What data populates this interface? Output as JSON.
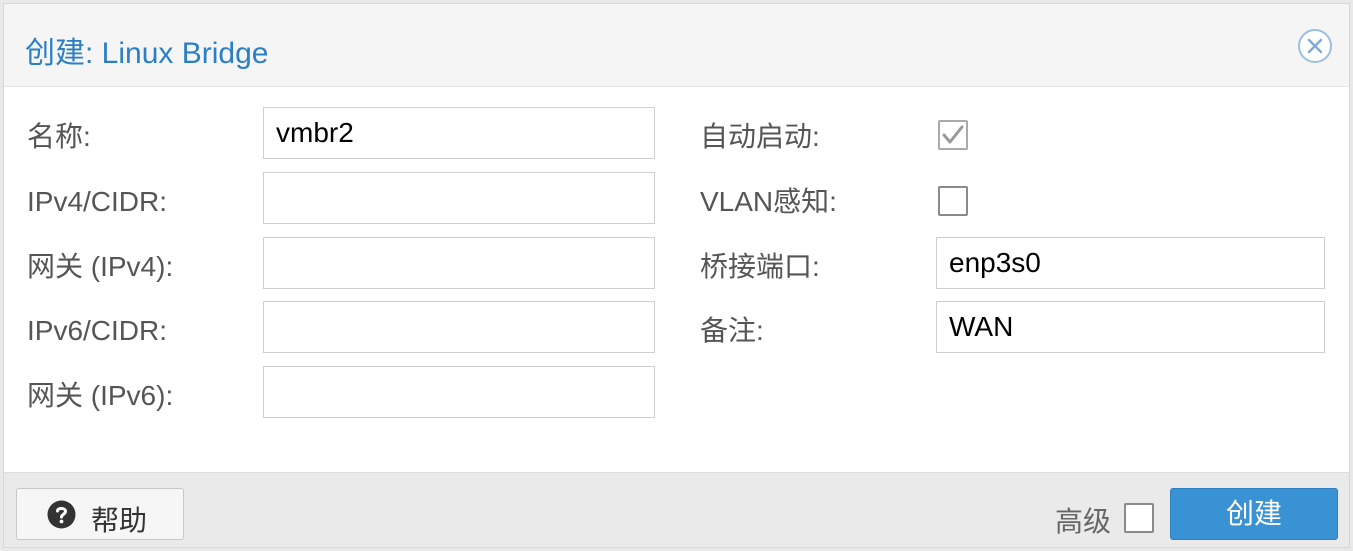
{
  "dialog": {
    "title": "创建: Linux Bridge",
    "close_icon": "close-circle-icon"
  },
  "form": {
    "left": [
      {
        "label": "名称:",
        "value": ""
      },
      {
        "label": "IPv4/CIDR:",
        "value": ""
      },
      {
        "label": "网关 (IPv4):",
        "value": ""
      },
      {
        "label": "IPv6/CIDR:",
        "value": ""
      },
      {
        "label": "网关 (IPv6):",
        "value": ""
      }
    ],
    "name_value": "vmbr2",
    "right": {
      "autostart_label": "自动启动:",
      "autostart_checked": true,
      "vlan_label": "VLAN感知:",
      "vlan_checked": false,
      "ports_label": "桥接端口:",
      "ports_value": "enp3s0",
      "comment_label": "备注:",
      "comment_value": "WAN"
    }
  },
  "footer": {
    "help_label": "帮助",
    "help_icon": "question-circle-icon",
    "advanced_label": "高级",
    "advanced_checked": false,
    "create_label": "创建"
  },
  "colors": {
    "title": "#2b7fc4",
    "primary_button": "#3892d4"
  }
}
